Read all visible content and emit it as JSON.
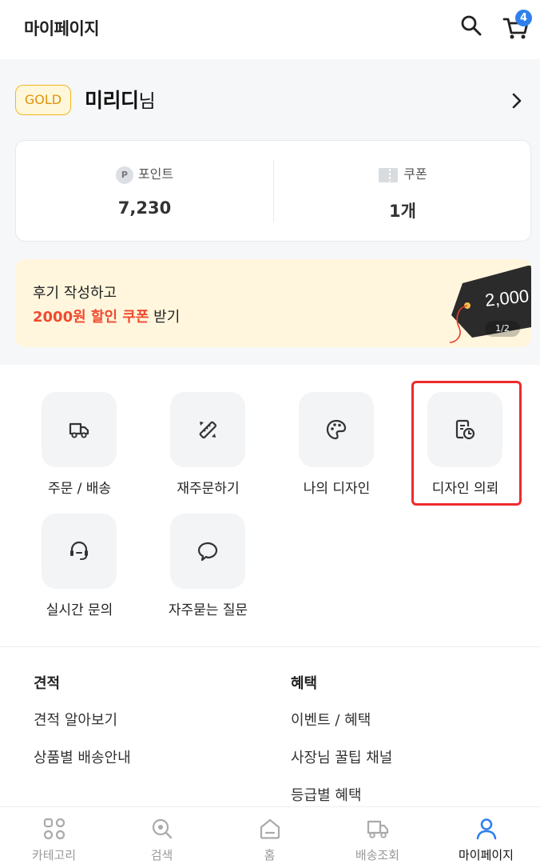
{
  "header": {
    "title": "마이페이지",
    "cart_count": "4"
  },
  "profile": {
    "grade": "GOLD",
    "name": "미리디",
    "suffix": "님"
  },
  "stats": {
    "point_icon": "P",
    "point_label": "포인트",
    "point_value": "7,230",
    "coupon_label": "쿠폰",
    "coupon_value": "1개"
  },
  "banner": {
    "line1": "후기 작성하고",
    "highlight": "2000원 할인 쿠폰",
    "line2_rest": " 받기",
    "tag_amount": "2,000",
    "pager": "1/2"
  },
  "menu": {
    "items": [
      {
        "label": "주문 / 배송",
        "icon": "truck-icon"
      },
      {
        "label": "재주문하기",
        "icon": "reorder-icon"
      },
      {
        "label": "나의 디자인",
        "icon": "palette-icon"
      },
      {
        "label": "디자인 의뢰",
        "icon": "design-request-icon"
      },
      {
        "label": "실시간 문의",
        "icon": "headset-icon"
      },
      {
        "label": "자주묻는 질문",
        "icon": "chat-bubble-icon"
      }
    ]
  },
  "links": {
    "estimate": {
      "heading": "견적",
      "items": [
        "견적 알아보기",
        "상품별 배송안내"
      ]
    },
    "benefits": {
      "heading": "혜택",
      "items": [
        "이벤트 / 혜택",
        "사장님 꿀팁 채널",
        "등급별 혜택"
      ]
    }
  },
  "bottom_nav": {
    "items": [
      {
        "label": "카테고리",
        "icon": "category-icon"
      },
      {
        "label": "검색",
        "icon": "search-icon"
      },
      {
        "label": "홈",
        "icon": "home-icon"
      },
      {
        "label": "배송조회",
        "icon": "delivery-icon"
      },
      {
        "label": "마이페이지",
        "icon": "user-icon",
        "active": true
      }
    ]
  },
  "colors": {
    "accent_blue": "#2f80ed",
    "gold": "#f5b51e",
    "highlight_red": "#f04a2f",
    "annotation_red": "#ee2b2b"
  }
}
